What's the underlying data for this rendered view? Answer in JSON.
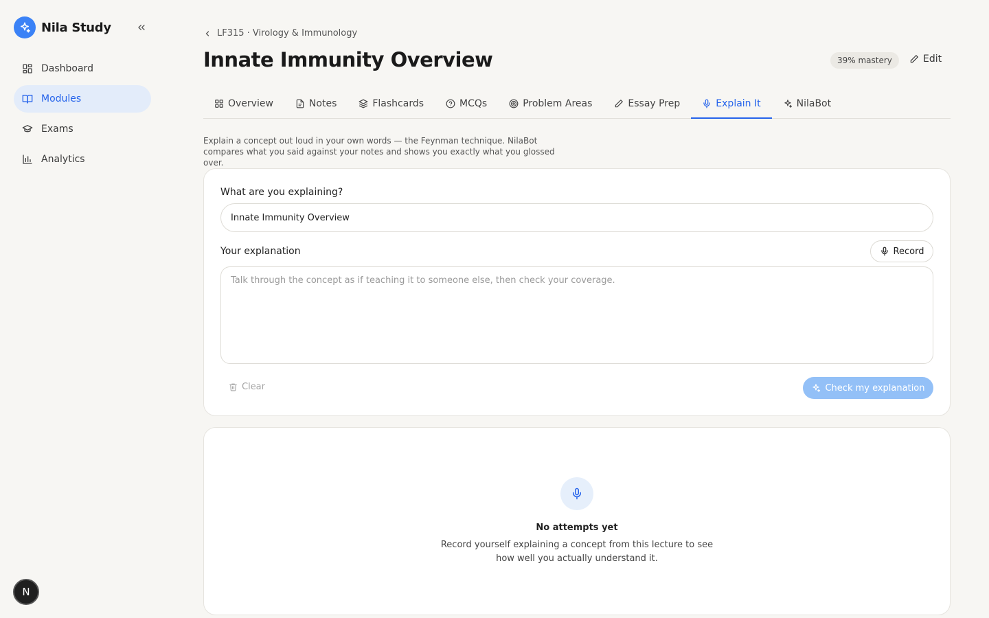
{
  "brand": {
    "name": "Nila Study",
    "logo_icon": "sparkles-icon",
    "accent": "#3b82f6"
  },
  "sidebar": {
    "collapse_icon": "chevrons-left-icon",
    "items": [
      {
        "label": "Dashboard",
        "icon": "grid-icon",
        "active": false
      },
      {
        "label": "Modules",
        "icon": "book-open-icon",
        "active": true
      },
      {
        "label": "Exams",
        "icon": "graduation-cap-icon",
        "active": false
      },
      {
        "label": "Analytics",
        "icon": "bar-chart-icon",
        "active": false
      }
    ],
    "user_initial": "N"
  },
  "header": {
    "breadcrumb": "LF315 · Virology & Immunology",
    "title": "Innate Immunity Overview",
    "mastery": "39% mastery",
    "edit_label": "Edit"
  },
  "tabs": [
    {
      "label": "Overview",
      "icon": "grid-icon"
    },
    {
      "label": "Notes",
      "icon": "file-text-icon"
    },
    {
      "label": "Flashcards",
      "icon": "layers-icon"
    },
    {
      "label": "MCQs",
      "icon": "help-circle-icon"
    },
    {
      "label": "Problem Areas",
      "icon": "target-icon"
    },
    {
      "label": "Essay Prep",
      "icon": "pencil-icon"
    },
    {
      "label": "Explain It",
      "icon": "mic-icon",
      "active": true
    },
    {
      "label": "NilaBot",
      "icon": "sparkles-icon"
    }
  ],
  "intro": "Explain a concept out loud in your own words — the Feynman technique. NilaBot compares what you said against your notes and shows you exactly what you glossed over.",
  "form": {
    "topic_label": "What are you explaining?",
    "topic_value": "Innate Immunity Overview",
    "explanation_label": "Your explanation",
    "record_label": "Record",
    "explanation_placeholder": "Talk through the concept as if teaching it to someone else, then check your coverage.",
    "clear_label": "Clear",
    "check_label": "Check my explanation"
  },
  "empty_state": {
    "icon": "mic-icon",
    "title": "No attempts yet",
    "description": "Record yourself explaining a concept from this lecture to see how well you actually understand it."
  }
}
